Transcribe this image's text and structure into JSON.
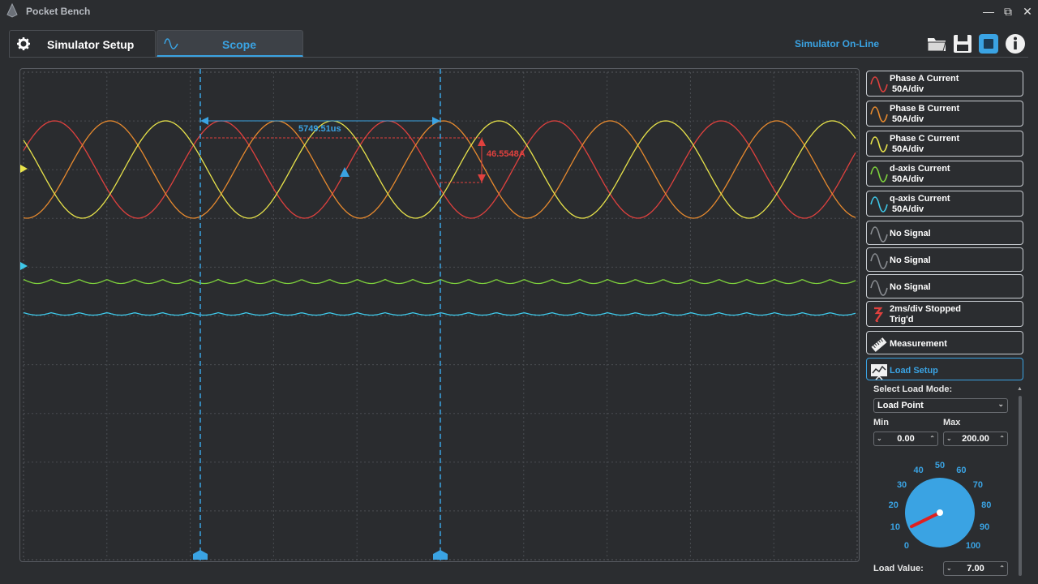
{
  "window": {
    "title": "Pocket Bench",
    "minimize": "—",
    "maximize": "⧉",
    "close": "✕"
  },
  "tabs": [
    {
      "label": "Simulator Setup",
      "icon": "gear-icon",
      "active": false
    },
    {
      "label": "Scope",
      "icon": "sine-wave-icon",
      "active": true
    }
  ],
  "toolbar": {
    "status": "Simulator On-Line",
    "icons": [
      "folder-icon",
      "save-icon",
      "stop-icon",
      "info-icon"
    ]
  },
  "scope": {
    "time_cursor_delta": "5749.51us",
    "amplitude_cursor_delta": "46.5548A",
    "channel_colors": {
      "phase_a": "#e0413e",
      "phase_b": "#e88a2e",
      "phase_c": "#e8e34a",
      "d_axis": "#7fd33c",
      "q_axis": "#3ec7e8",
      "cursor": "#3aa3e3"
    }
  },
  "channels": [
    {
      "name": "Phase A Current",
      "scale": "50A/div",
      "color": "#e0413e"
    },
    {
      "name": "Phase B Current",
      "scale": "50A/div",
      "color": "#e88a2e"
    },
    {
      "name": "Phase C Current",
      "scale": "50A/div",
      "color": "#e8e34a"
    },
    {
      "name": "d-axis Current",
      "scale": "50A/div",
      "color": "#7fd33c"
    },
    {
      "name": "q-axis Current",
      "scale": "50A/div",
      "color": "#3ec7e8"
    },
    {
      "name": "No Signal",
      "scale": "",
      "color": "#8a8d92"
    },
    {
      "name": "No Signal",
      "scale": "",
      "color": "#8a8d92"
    },
    {
      "name": "No Signal",
      "scale": "",
      "color": "#8a8d92"
    }
  ],
  "timebase": {
    "line1": "2ms/div Stopped",
    "line2": "Trig'd"
  },
  "measurement": {
    "label": "Measurement"
  },
  "load_setup": {
    "label": "Load Setup",
    "mode_label": "Select Load Mode:",
    "mode_value": "Load Point",
    "min_label": "Min",
    "max_label": "Max",
    "min_value": "0.00",
    "max_value": "200.00",
    "dial_ticks": [
      "0",
      "10",
      "20",
      "30",
      "40",
      "50",
      "60",
      "70",
      "80",
      "90",
      "100"
    ],
    "dial_value": 7,
    "value_label": "Load Value:",
    "value": "7.00"
  }
}
